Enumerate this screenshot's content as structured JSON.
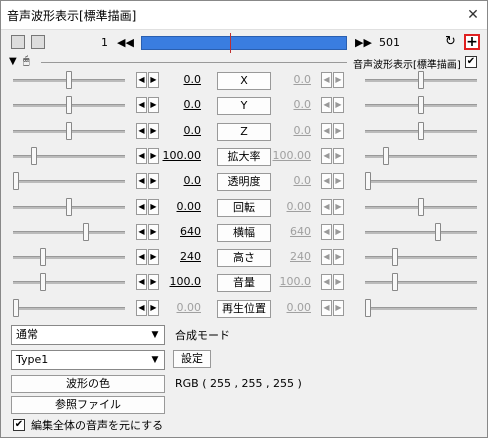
{
  "window": {
    "title": "音声波形表示[標準描画]"
  },
  "toolbar": {
    "start_frame": "1",
    "end_frame": "501",
    "playhead_fraction": 0.43
  },
  "header": {
    "filter_name": "音声波形表示[標準描画]",
    "enabled": true
  },
  "params": [
    {
      "label": "X",
      "left": "0.0",
      "right": "0.0",
      "left_slider": 0.5,
      "right_slider": 0.5,
      "left_dim": false
    },
    {
      "label": "Y",
      "left": "0.0",
      "right": "0.0",
      "left_slider": 0.5,
      "right_slider": 0.5,
      "left_dim": false
    },
    {
      "label": "Z",
      "left": "0.0",
      "right": "0.0",
      "left_slider": 0.5,
      "right_slider": 0.5,
      "left_dim": false
    },
    {
      "label": "拡大率",
      "left": "100.00",
      "right": "100.00",
      "left_slider": 0.17,
      "right_slider": 0.17,
      "left_dim": false
    },
    {
      "label": "透明度",
      "left": "0.0",
      "right": "0.0",
      "left_slider": 0.0,
      "right_slider": 0.0,
      "left_dim": false
    },
    {
      "label": "回転",
      "left": "0.00",
      "right": "0.00",
      "left_slider": 0.5,
      "right_slider": 0.5,
      "left_dim": false
    },
    {
      "label": "横幅",
      "left": "640",
      "right": "640",
      "left_slider": 0.66,
      "right_slider": 0.66,
      "left_dim": false
    },
    {
      "label": "高さ",
      "left": "240",
      "right": "240",
      "left_slider": 0.25,
      "right_slider": 0.25,
      "left_dim": false
    },
    {
      "label": "音量",
      "left": "100.0",
      "right": "100.0",
      "left_slider": 0.25,
      "right_slider": 0.25,
      "left_dim": false
    },
    {
      "label": "再生位置",
      "left": "0.00",
      "right": "0.00",
      "left_slider": 0.0,
      "right_slider": 0.0,
      "left_dim": true
    }
  ],
  "blend": {
    "value": "通常",
    "label": "合成モード"
  },
  "type_select": {
    "value": "Type1"
  },
  "settings_button": "設定",
  "waveform_color_button": "波形の色",
  "rgb_text": "RGB ( 255 , 255 , 255 )",
  "reference_file_button": "参照ファイル",
  "whole_audio": {
    "label": "編集全体の音声を元にする",
    "checked": true
  }
}
